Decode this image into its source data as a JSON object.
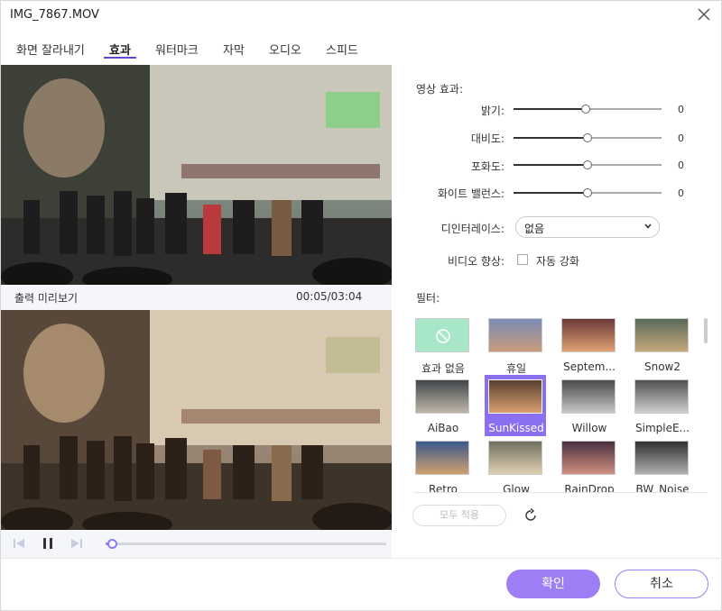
{
  "window": {
    "title": "IMG_7867.MOV"
  },
  "tabs": [
    {
      "label": "화면 잘라내기"
    },
    {
      "label": "효과"
    },
    {
      "label": "워터마크"
    },
    {
      "label": "자막"
    },
    {
      "label": "오디오"
    },
    {
      "label": "스피드"
    }
  ],
  "active_tab": "효과",
  "preview": {
    "output_label": "출력 미리보기",
    "timecode": "00:05/03:04",
    "progress": 0.02
  },
  "effects": {
    "title": "영상 효과:",
    "sliders": [
      {
        "label": "밝기:",
        "value": "0"
      },
      {
        "label": "대비도:",
        "value": "0"
      },
      {
        "label": "포화도:",
        "value": "0"
      },
      {
        "label": "화이트 밸런스:",
        "value": "0"
      }
    ],
    "deinterlace": {
      "label": "디인터레이스:",
      "value": "없음"
    },
    "enhance": {
      "label": "비디오 향상:",
      "checkbox_label": "자동 강화",
      "checked": false
    }
  },
  "filters": {
    "title": "필터:",
    "items": [
      {
        "name": "효과 없음",
        "selected": false
      },
      {
        "name": "휴일",
        "selected": false
      },
      {
        "name": "Septem...",
        "selected": false
      },
      {
        "name": "Snow2",
        "selected": false
      },
      {
        "name": "AiBao",
        "selected": false
      },
      {
        "name": "SunKissed",
        "selected": true
      },
      {
        "name": "Willow",
        "selected": false
      },
      {
        "name": "SimpleE...",
        "selected": false
      },
      {
        "name": "Retro",
        "selected": false
      },
      {
        "name": "Glow",
        "selected": false
      },
      {
        "name": "RainDrop",
        "selected": false
      },
      {
        "name": "BW_Noise",
        "selected": false
      }
    ],
    "apply_all_label": "모두 적용"
  },
  "buttons": {
    "ok": "확인",
    "cancel": "취소"
  },
  "colors": {
    "accent": "#9d7ef4",
    "selected_filter": "#8a6ff0"
  }
}
